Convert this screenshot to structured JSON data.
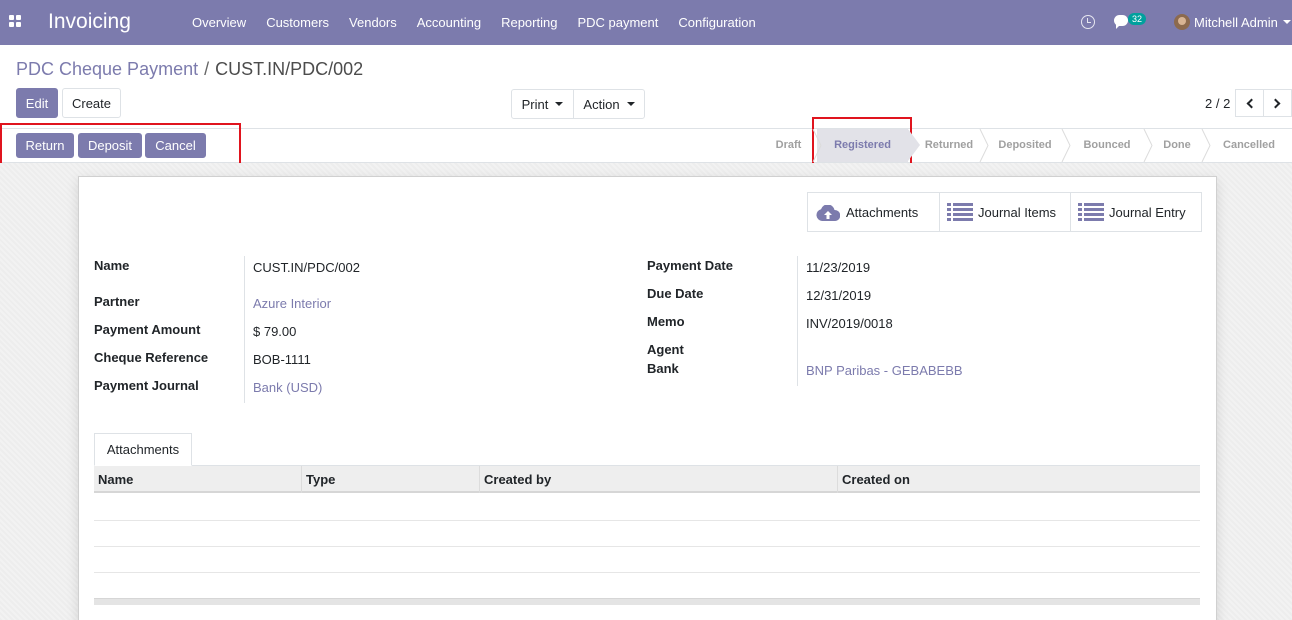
{
  "navbar": {
    "app_name": "Invoicing",
    "menu": [
      "Overview",
      "Customers",
      "Vendors",
      "Accounting",
      "Reporting",
      "PDC payment",
      "Configuration"
    ],
    "chat_count": "32",
    "user_name": "Mitchell Admin",
    "brand_color": "#7c7bad"
  },
  "breadcrumb": {
    "parent": "PDC Cheque Payment",
    "separator": "/",
    "current": "CUST.IN/PDC/002"
  },
  "buttons": {
    "edit": "Edit",
    "create": "Create",
    "print": "Print",
    "action": "Action"
  },
  "pager": {
    "value": "2 / 2"
  },
  "header_buttons": {
    "return": "Return",
    "deposit": "Deposit",
    "cancel": "Cancel"
  },
  "statusbar": {
    "stages": [
      "Draft",
      "Registered",
      "Returned",
      "Deposited",
      "Bounced",
      "Done",
      "Cancelled"
    ],
    "active": "Registered"
  },
  "smart_buttons": {
    "attachments": "Attachments",
    "journal_items": "Journal Items",
    "journal_entry": "Journal Entry"
  },
  "fields_left": {
    "name_label": "Name",
    "name_value": "CUST.IN/PDC/002",
    "partner_label": "Partner",
    "partner_value": "Azure Interior",
    "amount_label": "Payment Amount",
    "amount_value": "$ 79.00",
    "cheque_label": "Cheque Reference",
    "cheque_value": "BOB-1111",
    "journal_label": "Payment Journal",
    "journal_value": "Bank (USD)"
  },
  "fields_right": {
    "date_label": "Payment Date",
    "date_value": "11/23/2019",
    "due_label": "Due Date",
    "due_value": "12/31/2019",
    "memo_label": "Memo",
    "memo_value": "INV/2019/0018",
    "agent_label": "Agent",
    "bank_label": "Bank",
    "bank_value": "BNP Paribas - GEBABEBB"
  },
  "tabs": {
    "attachments": "Attachments"
  },
  "table": {
    "columns": [
      "Name",
      "Type",
      "Created by",
      "Created on"
    ]
  }
}
